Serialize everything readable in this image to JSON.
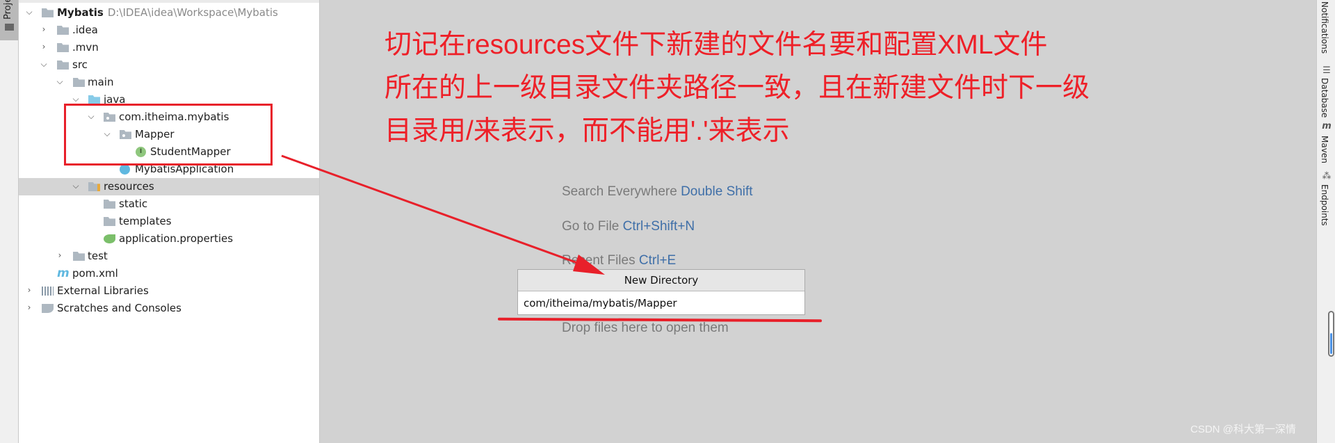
{
  "left_strip": {
    "project_tab": "Project"
  },
  "tree": {
    "root": {
      "name": "Mybatis",
      "path": "D:\\IDEA\\idea\\Workspace\\Mybatis"
    },
    "items": [
      ".idea",
      ".mvn",
      "src",
      "main",
      "java",
      "com.itheima.mybatis",
      "Mapper",
      "StudentMapper",
      "MybatisApplication",
      "resources",
      "static",
      "templates",
      "application.properties",
      "test",
      "pom.xml",
      "External Libraries",
      "Scratches and Consoles"
    ]
  },
  "annotation": {
    "lines": [
      "切记在resources文件下新建的文件名要和配置XML文件",
      "所在的上一级目录文件夹路径一致，且在新建文件时下一级",
      "目录用/来表示，而不能用'.'来表示"
    ],
    "color": "#ee2028"
  },
  "hints": [
    {
      "label": "Search Everywhere",
      "shortcut": "Double Shift"
    },
    {
      "label": "Go to File",
      "shortcut": "Ctrl+Shift+N"
    },
    {
      "label": "Recent Files",
      "shortcut": "Ctrl+E"
    },
    {
      "label": "Drop files here to open them",
      "shortcut": ""
    }
  ],
  "dialog": {
    "title": "New Directory",
    "value": "com/itheima/mybatis/Mapper"
  },
  "right_strip": [
    "Notifications",
    "Database",
    "Maven",
    "Endpoints"
  ],
  "watermark": "CSDN @科大第一深情"
}
